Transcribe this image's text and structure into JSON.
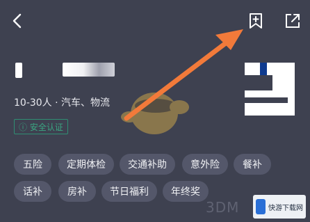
{
  "header": {
    "back_icon": "chevron-left-icon",
    "bookmark_icon": "bookmark-add-icon",
    "share_icon": "share-icon"
  },
  "company": {
    "meta": "10-30人 · 汽车、物流",
    "verify_label": "ⓘ 安全认证"
  },
  "benefits": {
    "tags": [
      "五险",
      "定期体检",
      "交通补助",
      "意外险",
      "餐补",
      "话补",
      "房补",
      "节日福利",
      "年终奖"
    ]
  },
  "watermark": {
    "text": "3DM",
    "site_name": "快游下载网"
  },
  "colors": {
    "background": "#3e4150",
    "tag_background": "#54576a",
    "arrow": "#f27a3a",
    "verify": "#3aa581"
  }
}
